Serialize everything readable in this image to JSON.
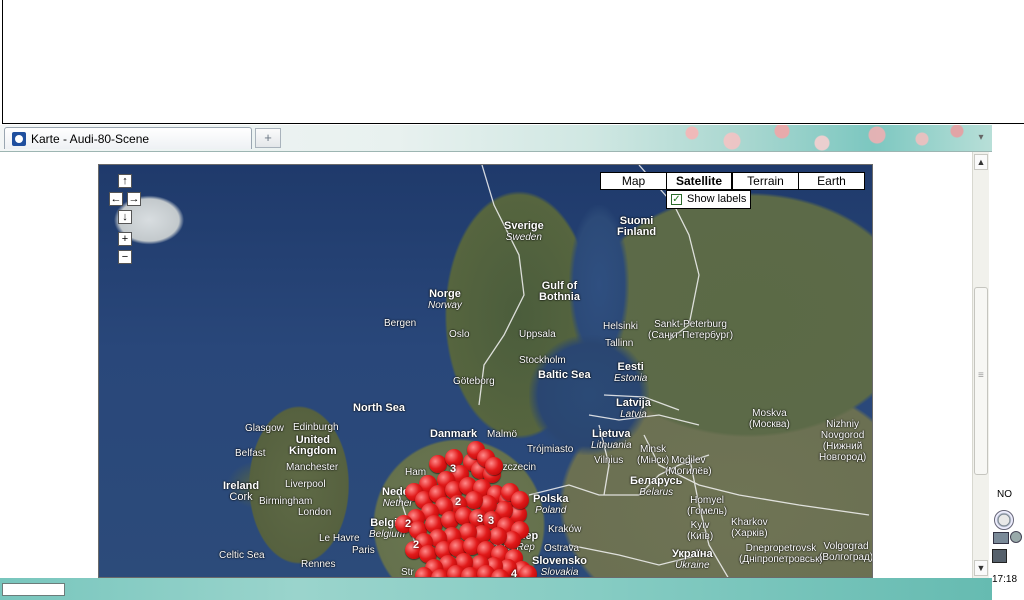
{
  "browser": {
    "tab_title": "Karte - Audi-80-Scene",
    "new_tab_label": "+",
    "tab_menu_label": "▾"
  },
  "map": {
    "map_types": [
      {
        "label": "Map",
        "active": false
      },
      {
        "label": "Satellite",
        "active": true
      },
      {
        "label": "Terrain",
        "active": false
      },
      {
        "label": "Earth",
        "active": false
      }
    ],
    "show_labels_text": "Show labels",
    "show_labels_checked": true,
    "nav": {
      "up": "↑",
      "left": "←",
      "right": "→",
      "down": "↓",
      "zoom_in": "+",
      "zoom_out": "−"
    },
    "place_labels": {
      "sverige": "Sverige",
      "sverige_sub": "Sweden",
      "suomi": "Suomi",
      "suomi_sub": "Finland",
      "gulf": "Gulf of",
      "gulf2": "Bothnia",
      "norge": "Norge",
      "norge_sub": "Norway",
      "bergen": "Bergen",
      "oslo": "Oslo",
      "uppsala": "Uppsala",
      "helsinki": "Helsinki",
      "spb": "Sankt-Peterburg",
      "spb_sub": "(Санкт-Петербург)",
      "tallinn": "Tallinn",
      "stockholm": "Stockholm",
      "baltic": "Baltic Sea",
      "eesti": "Eesti",
      "eesti_sub": "Estonia",
      "north_sea": "North Sea",
      "goteborg": "Göteborg",
      "latvija": "Latvija",
      "latvija_sub": "Latvia",
      "moskva": "Moskva",
      "moskva_sub": "(Москва)",
      "nizhny": "Nizhniy",
      "nizhny2": "Novgorod",
      "nizhny3": "(Нижний",
      "nizhny4": "Новгород)",
      "glasgow": "Glasgow",
      "edinburgh": "Edinburgh",
      "uk": "United",
      "uk2": "Kingdom",
      "belfast": "Belfast",
      "manchester": "Manchester",
      "ireland": "Ireland",
      "ireland_sub": "Cork",
      "liverpool": "Liverpool",
      "birmingham": "Birmingham",
      "london": "London",
      "danmark": "Danmark",
      "malmo": "Malmö",
      "trojmiasto": "Trójmiasto",
      "lietuva": "Lietuva",
      "lietuva_sub": "Lithuania",
      "vilnius": "Vilnius",
      "minsk": "Minsk",
      "minsk_sub": "(Мінск)",
      "mogilev": "Mogilev",
      "mogilev_sub": "(Могилёв)",
      "belarus": "Беларусь",
      "belarus_sub": "Belarus",
      "hamburg": "Ham",
      "szczecin": "Szczecin",
      "nederland": "Neder",
      "nederland_sub": "Nether",
      "polska": "Polska",
      "polska_sub": "Poland",
      "belgie": "Belgiq",
      "belgie_sub": "Belgium",
      "homyel": "Homyel",
      "homyel_sub": "(Гомель)",
      "kyiv": "Kyiv",
      "kyiv_sub": "(Київ)",
      "kharkov": "Kharkov",
      "kharkov_sub": "(Харків)",
      "krakow": "Kraków",
      "ceska": "Česká Rep",
      "ceska_sub": "Czech Rep",
      "le_havre": "Le Havre",
      "paris": "Paris",
      "ostrava": "Ostrava",
      "dnipro": "Dnepropetrovsk",
      "dnipro_sub": "(Дніпропетровськ)",
      "volgograd": "Volgograd",
      "volgograd_sub": "(Волгоград)",
      "celtic": "Celtic Sea",
      "rennes": "Rennes",
      "slovensko": "Slovensko",
      "slovensko_sub": "Slovakia",
      "ukraina": "Україна",
      "ukraina_sub": "Ukraine",
      "sturgart": "Str"
    },
    "marker_numbers": [
      "3",
      "2",
      "3",
      "2",
      "3",
      "2",
      "4"
    ]
  },
  "tray": {
    "lang": "NO",
    "clock": "17:18"
  },
  "colors": {
    "marker_red": "#e11a1a",
    "theme_teal": "#78c6bd"
  }
}
